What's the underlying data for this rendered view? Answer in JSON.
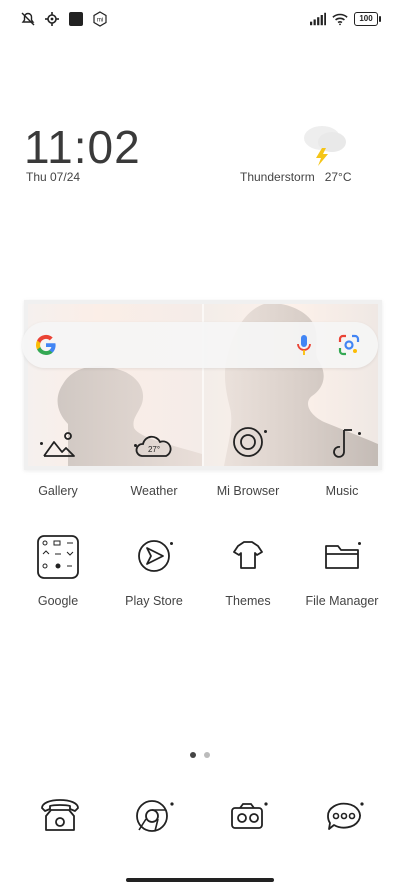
{
  "status_bar": {
    "left_icons": [
      "muted-icon",
      "settings-icon",
      "square-icon",
      "mi-icon"
    ],
    "right_icons": [
      "signal-icon",
      "wifi-icon"
    ],
    "battery": "100"
  },
  "clock": {
    "time": "11:02",
    "date": "Thu 07/24"
  },
  "weather": {
    "condition": "Thunderstorm",
    "temperature": "27°C"
  },
  "search": {
    "provider": "Google"
  },
  "apps_row1": [
    {
      "label": "Gallery",
      "icon": "gallery-icon"
    },
    {
      "label": "Weather",
      "icon": "weather-app-icon",
      "badge": "27°"
    },
    {
      "label": "Mi Browser",
      "icon": "browser-icon"
    },
    {
      "label": "Music",
      "icon": "music-icon"
    }
  ],
  "apps_row2": [
    {
      "label": "Google",
      "icon": "google-folder-icon"
    },
    {
      "label": "Play Store",
      "icon": "play-store-icon"
    },
    {
      "label": "Themes",
      "icon": "themes-icon"
    },
    {
      "label": "File Manager",
      "icon": "file-manager-icon"
    }
  ],
  "pager": {
    "pages": 2,
    "current": 1
  },
  "dock": [
    "phone-icon",
    "chrome-icon",
    "camera-icon",
    "messages-icon"
  ],
  "colors": {
    "google_blue": "#4285F4",
    "google_red": "#EA4335",
    "google_yellow": "#FBBC05",
    "google_green": "#34A853",
    "thunder_yellow": "#F5C518"
  }
}
